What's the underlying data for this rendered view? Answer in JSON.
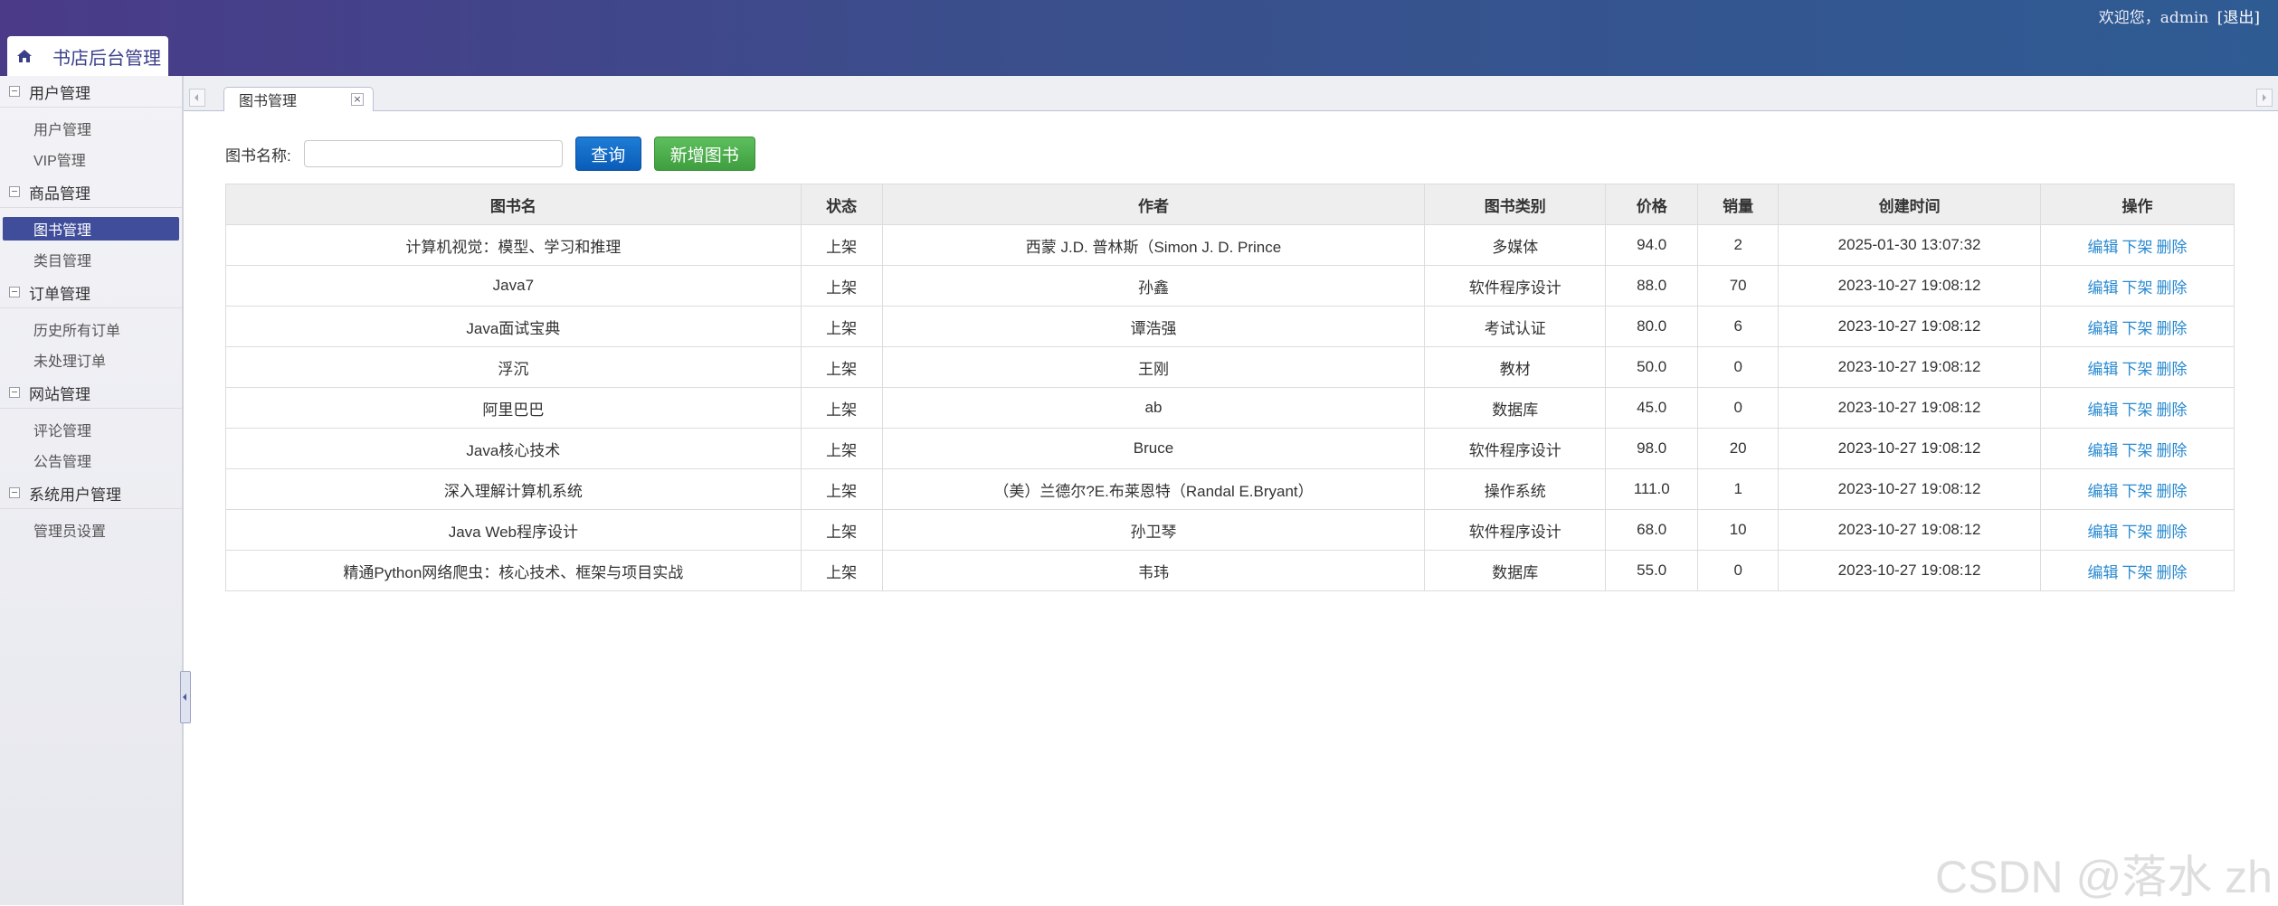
{
  "header": {
    "welcome": "欢迎您，admin",
    "logout": "[退出]",
    "brand": "书店后台管理",
    "brand_icon": "home-icon"
  },
  "sidebar": {
    "groups": [
      {
        "label": "用户管理",
        "items": [
          {
            "label": "用户管理"
          },
          {
            "label": "VIP管理"
          }
        ]
      },
      {
        "label": "商品管理",
        "items": [
          {
            "label": "图书管理",
            "active": true
          },
          {
            "label": "类目管理"
          }
        ]
      },
      {
        "label": "订单管理",
        "items": [
          {
            "label": "历史所有订单"
          },
          {
            "label": "未处理订单"
          }
        ]
      },
      {
        "label": "网站管理",
        "items": [
          {
            "label": "评论管理"
          },
          {
            "label": "公告管理"
          }
        ]
      },
      {
        "label": "系统用户管理",
        "items": [
          {
            "label": "管理员设置"
          }
        ]
      }
    ]
  },
  "tabs": {
    "active": "图书管理"
  },
  "search": {
    "label": "图书名称:",
    "value": "",
    "placeholder": "",
    "query_button": "查询",
    "add_button": "新增图书"
  },
  "table": {
    "headers": [
      "图书名",
      "状态",
      "作者",
      "图书类别",
      "价格",
      "销量",
      "创建时间",
      "操作"
    ],
    "ops": [
      "编辑",
      "下架",
      "删除"
    ],
    "rows": [
      [
        "计算机视觉：模型、学习和推理",
        "上架",
        "西蒙 J.D. 普林斯（Simon J. D. Prince",
        "多媒体",
        "94.0",
        "2",
        "2025-01-30 13:07:32"
      ],
      [
        "Java7",
        "上架",
        "孙鑫",
        "软件程序设计",
        "88.0",
        "70",
        "2023-10-27 19:08:12"
      ],
      [
        "Java面试宝典",
        "上架",
        "谭浩强",
        "考试认证",
        "80.0",
        "6",
        "2023-10-27 19:08:12"
      ],
      [
        "浮沉",
        "上架",
        "王刚",
        "教材",
        "50.0",
        "0",
        "2023-10-27 19:08:12"
      ],
      [
        "阿里巴巴",
        "上架",
        "ab",
        "数据库",
        "45.0",
        "0",
        "2023-10-27 19:08:12"
      ],
      [
        "Java核心技术",
        "上架",
        "Bruce",
        "软件程序设计",
        "98.0",
        "20",
        "2023-10-27 19:08:12"
      ],
      [
        "深入理解计算机系统",
        "上架",
        "（美）兰德尔?E.布莱恩特（Randal E.Bryant）",
        "操作系统",
        "111.0",
        "1",
        "2023-10-27 19:08:12"
      ],
      [
        "Java Web程序设计",
        "上架",
        "孙卫琴",
        "软件程序设计",
        "68.0",
        "10",
        "2023-10-27 19:08:12"
      ],
      [
        "精通Python网络爬虫：核心技术、框架与项目实战",
        "上架",
        "韦玮",
        "数据库",
        "55.0",
        "0",
        "2023-10-27 19:08:12"
      ]
    ]
  },
  "watermark": "CSDN @落水 zh",
  "colors": {
    "header": "#3f4d8f",
    "active_item": "#3f4d9a",
    "link": "#2a8ad0",
    "query_btn": "#0a5cb8",
    "add_btn": "#3f9e3f"
  }
}
